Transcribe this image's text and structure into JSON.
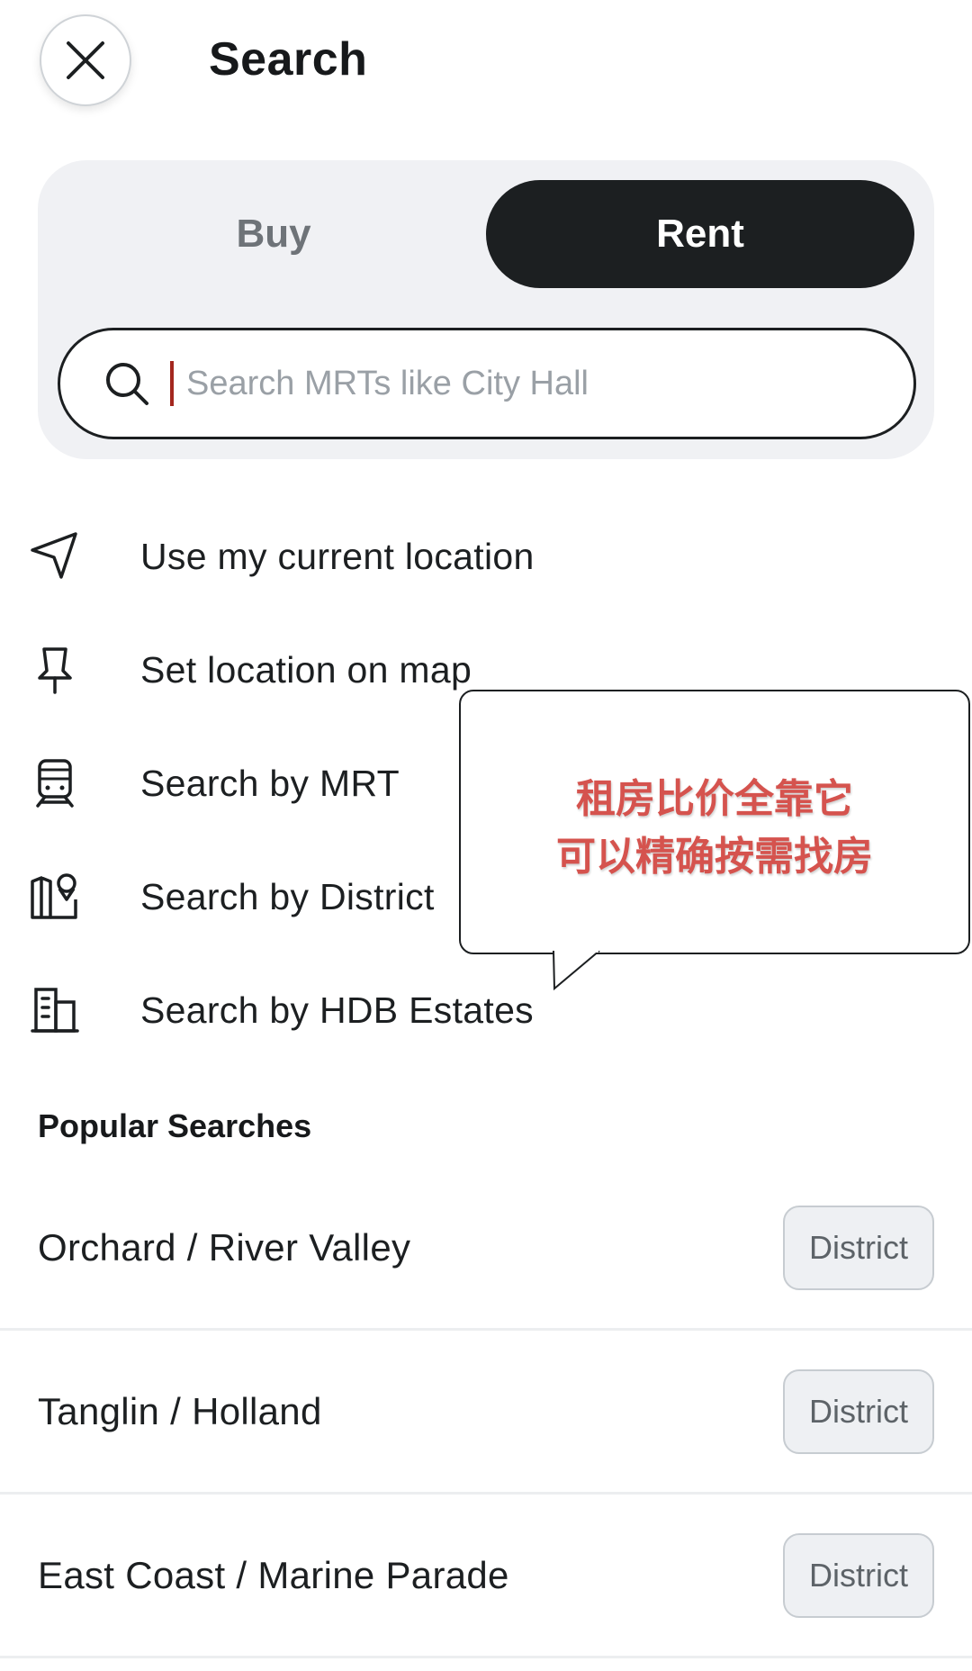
{
  "header": {
    "title": "Search",
    "close_icon": "close-icon"
  },
  "tabs": [
    {
      "label": "Buy",
      "selected": false
    },
    {
      "label": "Rent",
      "selected": true
    }
  ],
  "search": {
    "placeholder": "Search MRTs like City Hall",
    "value": "",
    "icon": "search-icon",
    "caret_color": "#a3271e"
  },
  "options": [
    {
      "label": "Use my current location",
      "icon": "navigation-arrow-icon"
    },
    {
      "label": "Set location on map",
      "icon": "map-pin-icon"
    },
    {
      "label": "Search by MRT",
      "icon": "train-icon"
    },
    {
      "label": "Search by District",
      "icon": "map-district-icon"
    },
    {
      "label": "Search by HDB Estates",
      "icon": "building-icon"
    }
  ],
  "tooltip": {
    "line1": "租房比价全靠它",
    "line2": "可以精确按需找房",
    "text_color": "#d5534e"
  },
  "popular": {
    "title": "Popular Searches",
    "items": [
      {
        "name": "Orchard / River Valley",
        "badge": "District"
      },
      {
        "name": "Tanglin / Holland",
        "badge": "District"
      },
      {
        "name": "East Coast / Marine Parade",
        "badge": "District"
      }
    ]
  },
  "colors": {
    "primary_dark": "#1c1f21",
    "card_bg": "#f0f1f4",
    "muted_text": "#6e7378"
  }
}
